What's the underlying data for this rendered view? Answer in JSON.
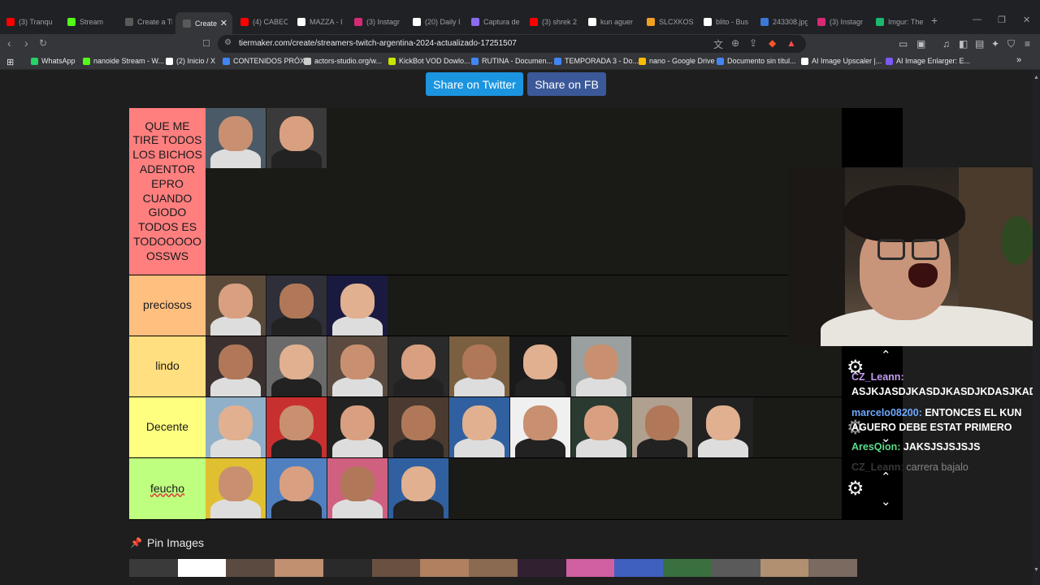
{
  "browser": {
    "tabs": [
      {
        "label": "(3) Tranqu",
        "favicon_color": "#ff0000"
      },
      {
        "label": "Stream",
        "favicon_color": "#53fc18"
      },
      {
        "label": "Create a Ti",
        "favicon_color": "#5a5a5a"
      },
      {
        "label": "Create",
        "favicon_color": "#5a5a5a",
        "active": true
      },
      {
        "label": "(4) CABEC",
        "favicon_color": "#ff0000"
      },
      {
        "label": "MAZZA - I",
        "favicon_color": "#ffffff"
      },
      {
        "label": "(3) Instagr",
        "favicon_color": "#d62976"
      },
      {
        "label": "(20) Daily I",
        "favicon_color": "#ffffff"
      },
      {
        "label": "Captura de",
        "favicon_color": "#8a6cf0"
      },
      {
        "label": "(3) shrek 2",
        "favicon_color": "#ff0000"
      },
      {
        "label": "kun aguer",
        "favicon_color": "#ffffff"
      },
      {
        "label": "SLCXKOS?",
        "favicon_color": "#f0a020"
      },
      {
        "label": "blito - Bus",
        "favicon_color": "#ffffff"
      },
      {
        "label": "243308.jpg",
        "favicon_color": "#3c78d8"
      },
      {
        "label": "(3) Instagr",
        "favicon_color": "#d62976"
      },
      {
        "label": "Imgur: The",
        "favicon_color": "#1bb76e"
      }
    ],
    "tab_close": "✕",
    "new_tab": "+",
    "window_controls": {
      "minimize": "—",
      "restore": "❐",
      "close": "✕"
    },
    "url": "tiermaker.com/create/streamers-twitch-argentina-2024-actualizado-17251507",
    "bookmarks": [
      {
        "label": "WhatsApp",
        "favicon_color": "#25d366"
      },
      {
        "label": "nanoide Stream - W...",
        "favicon_color": "#53fc18"
      },
      {
        "label": "(2) Inicio / X",
        "favicon_color": "#ffffff"
      },
      {
        "label": "CONTENIDOS PRÓX...",
        "favicon_color": "#4285f4"
      },
      {
        "label": "actors-studio.org/w...",
        "favicon_color": "#cccccc"
      },
      {
        "label": "KickBot VOD Dowlo...",
        "favicon_color": "#c8e600"
      },
      {
        "label": "RUTINA - Documen...",
        "favicon_color": "#4285f4"
      },
      {
        "label": "TEMPORADA 3 - Do...",
        "favicon_color": "#4285f4"
      },
      {
        "label": "nano - Google Drive",
        "favicon_color": "#fbbc04"
      },
      {
        "label": "Documento sin títul...",
        "favicon_color": "#4285f4"
      },
      {
        "label": "AI Image Upscaler |...",
        "favicon_color": "#ffffff"
      },
      {
        "label": "AI Image Enlarger: E...",
        "favicon_color": "#7a5af8"
      }
    ],
    "bookmarks_more": "»"
  },
  "page": {
    "share_twitter": "Share on Twitter",
    "share_fb": "Share on FB",
    "tiers": [
      {
        "label": "QUE ME TIRE TODOS LOS BICHOS ADENTOR EPRO CUANDO GIODO TODOS ES TODOOOOO OSSWS",
        "color": "#ff7f7f",
        "images": 2
      },
      {
        "label": "preciosos",
        "color": "#ffbf7f",
        "images": 3
      },
      {
        "label": "lindo",
        "color": "#ffdf7f",
        "images": 7
      },
      {
        "label": "Decente",
        "color": "#ffff7f",
        "images": 9
      },
      {
        "label": "feucho",
        "color": "#bfff7f",
        "images": 4
      }
    ],
    "pin_images_label": "Pin Images"
  },
  "chat": {
    "messages": [
      {
        "user": "CZ_Leann",
        "user_color": "#c39cf0",
        "text": "ASJKJASDJKASDJKASDJKDASJKADS"
      },
      {
        "user": "marcelo08200",
        "user_color": "#6ea8ff",
        "text": "ENTONCES EL KUN AGUERO DEBE ESTAT PRIMERO"
      },
      {
        "user": "AresQion",
        "user_color": "#5ddc8a",
        "text": "JAKSJSJSJSJS"
      },
      {
        "user": "CZ_Leann",
        "user_color": "#7a7a7a",
        "text": "carrera bajalo"
      }
    ]
  }
}
